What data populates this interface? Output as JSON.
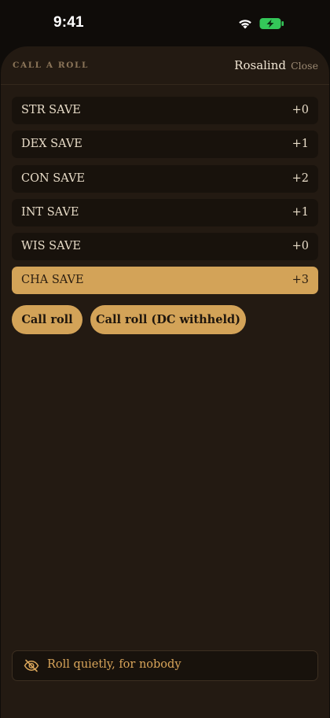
{
  "status_bar": {
    "time": "9:41",
    "icons": [
      "wifi-icon",
      "battery-charging-icon"
    ]
  },
  "sheet": {
    "title": "CALL A ROLL",
    "character_name": "Rosalind",
    "close_label": "Close"
  },
  "saves": [
    {
      "label": "STR SAVE",
      "modifier": "+0",
      "selected": false
    },
    {
      "label": "DEX SAVE",
      "modifier": "+1",
      "selected": false
    },
    {
      "label": "CON SAVE",
      "modifier": "+2",
      "selected": false
    },
    {
      "label": "INT SAVE",
      "modifier": "+1",
      "selected": false
    },
    {
      "label": "WIS SAVE",
      "modifier": "+0",
      "selected": false
    },
    {
      "label": "CHA SAVE",
      "modifier": "+3",
      "selected": true
    }
  ],
  "actions": {
    "call_roll": "Call roll",
    "call_roll_dc_withheld": "Call roll (DC withheld)"
  },
  "quiet_roll": {
    "icon": "eye-off-icon",
    "label": "Roll quietly, for nobody"
  },
  "colors": {
    "background": "#231a12",
    "accent": "#d3a358",
    "row": "#18120c",
    "muted_title": "#8a7458",
    "battery_green": "#34c759"
  }
}
